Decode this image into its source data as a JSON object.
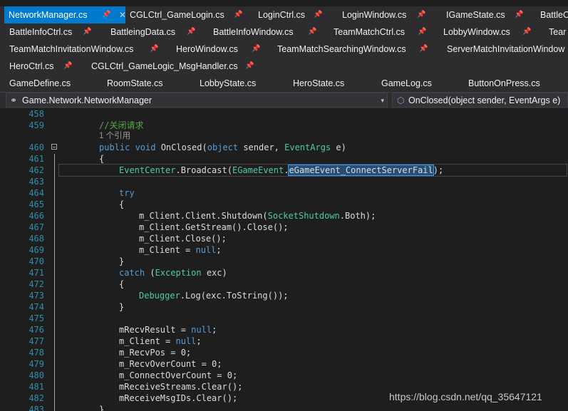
{
  "tabs": {
    "row1": [
      {
        "label": "NetworkManager.cs",
        "active": true
      },
      {
        "label": "CGLCtrl_GameLogin.cs"
      },
      {
        "label": "LoginCtrl.cs"
      },
      {
        "label": "LoginWindow.cs"
      },
      {
        "label": "IGameState.cs"
      },
      {
        "label": "BattleC"
      }
    ],
    "row2": [
      {
        "label": "BattleInfoCtrl.cs"
      },
      {
        "label": "BattleingData.cs"
      },
      {
        "label": "BattleInfoWindow.cs"
      },
      {
        "label": "TeamMatchCtrl.cs"
      },
      {
        "label": "LobbyWindow.cs"
      },
      {
        "label": "Tear"
      }
    ],
    "row3": [
      {
        "label": "TeamMatchInvitationWindow.cs"
      },
      {
        "label": "HeroWindow.cs"
      },
      {
        "label": "TeamMatchSearchingWindow.cs"
      },
      {
        "label": "ServerMatchInvitationWindow"
      }
    ],
    "row4": [
      {
        "label": "HeroCtrl.cs"
      },
      {
        "label": "CGLCtrl_GameLogic_MsgHandler.cs"
      }
    ],
    "row5": [
      {
        "label": "GameDefine.cs"
      },
      {
        "label": "RoomState.cs"
      },
      {
        "label": "LobbyState.cs"
      },
      {
        "label": "HeroState.cs"
      },
      {
        "label": "GameLog.cs"
      },
      {
        "label": "ButtonOnPress.cs"
      }
    ]
  },
  "navbar": {
    "class_selector": "Game.Network.NetworkManager",
    "member_selector": "OnClosed(object sender, EventArgs e)"
  },
  "editor": {
    "line_numbers": [
      "458",
      "459",
      "460",
      "461",
      "462",
      "463",
      "464",
      "465",
      "466",
      "467",
      "468",
      "469",
      "470",
      "471",
      "472",
      "473",
      "474",
      "475",
      "476",
      "477",
      "478",
      "479",
      "480",
      "481",
      "482",
      "483"
    ],
    "comment": "//关闭请求",
    "codelens": "1 个引用",
    "l460_pre": "public void ",
    "l460_name": "OnClosed(",
    "l460_k": "object",
    "l460_sender": " sender, ",
    "l460_t": "EventArgs",
    "l460_post": " e)",
    "brace_open": "{",
    "brace_close": "}",
    "l462_t": "EventCenter",
    "l462_mid": ".Broadcast(",
    "l462_t2": "EGameEvent",
    "l462_dot": ".",
    "l462_sel": "eGameEvent_ConnectServerFail",
    "l462_end": ");",
    "try": "try",
    "l466_pre": "m_Client.Client.Shutdown(",
    "l466_t": "SocketShutdown",
    "l466_post": ".Both);",
    "l467": "m_Client.GetStream().Close();",
    "l468": "m_Client.Close();",
    "l469_pre": "m_Client = ",
    "l469_k": "null",
    "l469_post": ";",
    "catch": "catch",
    "l471_open": " (",
    "l471_t": "Exception",
    "l471_post": " exc)",
    "l473_t": "Debugger",
    "l473_post": ".Log(exc.ToString());",
    "l476_pre": "mRecvResult = ",
    "l476_k": "null",
    "l476_post": ";",
    "l477_pre": "m_Client = ",
    "l477_k": "null",
    "l477_post": ";",
    "l478": "m_RecvPos = 0;",
    "l479": "m_RecvOverCount = 0;",
    "l480": "m_ConnectOverCount = 0;",
    "l481": "mReceiveStreams.Clear();",
    "l482": "mReceiveMsgIDs.Clear();",
    "l483": "}"
  },
  "watermark": "https://blog.csdn.net/qq_35647121",
  "colors": {
    "keyword": "#569cd6",
    "type": "#4ec9b0",
    "comment": "#57a64a",
    "linenumber": "#2b91af",
    "active_tab": "#007acc"
  }
}
